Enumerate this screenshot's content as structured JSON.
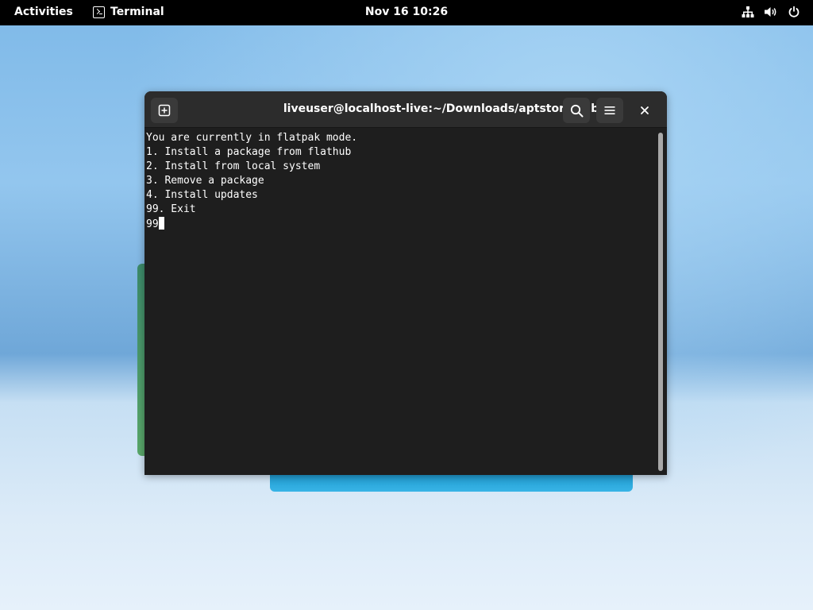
{
  "topbar": {
    "activities": "Activities",
    "app_name": "Terminal",
    "app_icon": "terminal-icon",
    "clock": "Nov 16  10:26",
    "tray_icons": [
      "network-icon",
      "volume-icon",
      "power-icon"
    ]
  },
  "terminal": {
    "title": "liveuser@localhost-live:~/Downloads/aptstore — bash",
    "buttons": {
      "new_tab": "new-tab-icon",
      "search": "search-icon",
      "menu": "hamburger-menu-icon",
      "close": "close-icon"
    },
    "lines": [
      "You are currently in flatpak mode.",
      "1. Install a package from flathub",
      "2. Install from local system",
      "3. Remove a package",
      "4. Install updates",
      "99. Exit"
    ],
    "prompt_input": "99"
  },
  "colors": {
    "topbar_bg": "#000000",
    "terminal_bg": "#1e1e1e",
    "headerbar_bg": "#2c2c2c",
    "text": "#ffffff"
  }
}
